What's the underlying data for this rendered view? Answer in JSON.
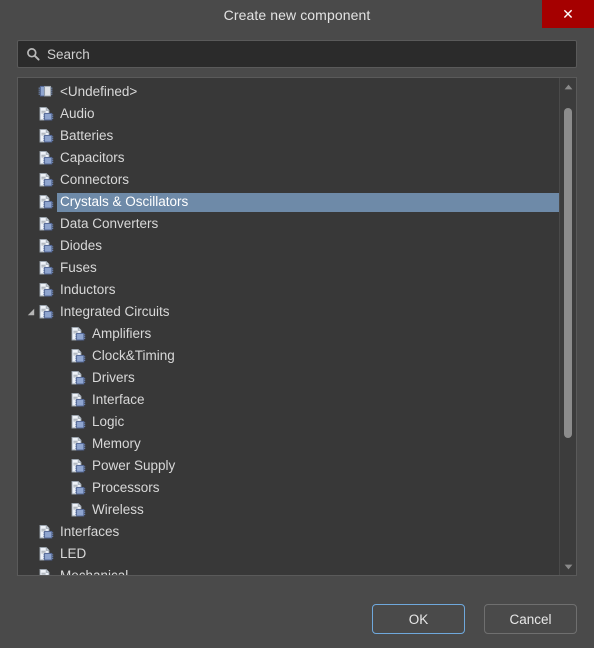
{
  "window": {
    "title": "Create new component",
    "close_icon": "close-x-icon",
    "close_color": "#a50000"
  },
  "search": {
    "icon": "search-icon",
    "placeholder": "Search",
    "value": ""
  },
  "tree": {
    "selected_label": "Crystals & Oscillators",
    "selection_color": "#6e8aa8",
    "items": [
      {
        "label": "<Undefined>",
        "level": 0,
        "icon": "chip-icon",
        "selected": false,
        "twisty": "none"
      },
      {
        "label": "Audio",
        "level": 0,
        "icon": "component-page-icon",
        "selected": false,
        "twisty": "none"
      },
      {
        "label": "Batteries",
        "level": 0,
        "icon": "component-page-icon",
        "selected": false,
        "twisty": "none"
      },
      {
        "label": "Capacitors",
        "level": 0,
        "icon": "component-page-icon",
        "selected": false,
        "twisty": "none"
      },
      {
        "label": "Connectors",
        "level": 0,
        "icon": "component-page-icon",
        "selected": false,
        "twisty": "none"
      },
      {
        "label": "Crystals & Oscillators",
        "level": 0,
        "icon": "component-page-icon",
        "selected": true,
        "twisty": "none"
      },
      {
        "label": "Data Converters",
        "level": 0,
        "icon": "component-page-icon",
        "selected": false,
        "twisty": "none"
      },
      {
        "label": "Diodes",
        "level": 0,
        "icon": "component-page-icon",
        "selected": false,
        "twisty": "none"
      },
      {
        "label": "Fuses",
        "level": 0,
        "icon": "component-page-icon",
        "selected": false,
        "twisty": "none"
      },
      {
        "label": "Inductors",
        "level": 0,
        "icon": "component-page-icon",
        "selected": false,
        "twisty": "none"
      },
      {
        "label": "Integrated Circuits",
        "level": 0,
        "icon": "component-page-icon",
        "selected": false,
        "twisty": "expanded"
      },
      {
        "label": "Amplifiers",
        "level": 1,
        "icon": "component-page-icon",
        "selected": false,
        "twisty": "none"
      },
      {
        "label": "Clock&Timing",
        "level": 1,
        "icon": "component-page-icon",
        "selected": false,
        "twisty": "none"
      },
      {
        "label": "Drivers",
        "level": 1,
        "icon": "component-page-icon",
        "selected": false,
        "twisty": "none"
      },
      {
        "label": "Interface",
        "level": 1,
        "icon": "component-page-icon",
        "selected": false,
        "twisty": "none"
      },
      {
        "label": "Logic",
        "level": 1,
        "icon": "component-page-icon",
        "selected": false,
        "twisty": "none"
      },
      {
        "label": "Memory",
        "level": 1,
        "icon": "component-page-icon",
        "selected": false,
        "twisty": "none"
      },
      {
        "label": "Power Supply",
        "level": 1,
        "icon": "component-page-icon",
        "selected": false,
        "twisty": "none"
      },
      {
        "label": "Processors",
        "level": 1,
        "icon": "component-page-icon",
        "selected": false,
        "twisty": "none"
      },
      {
        "label": "Wireless",
        "level": 1,
        "icon": "component-page-icon",
        "selected": false,
        "twisty": "none"
      },
      {
        "label": "Interfaces",
        "level": 0,
        "icon": "component-page-icon",
        "selected": false,
        "twisty": "none"
      },
      {
        "label": "LED",
        "level": 0,
        "icon": "component-page-icon",
        "selected": false,
        "twisty": "none"
      },
      {
        "label": "Mechanical",
        "level": 0,
        "icon": "component-page-icon",
        "selected": false,
        "twisty": "none"
      }
    ]
  },
  "scrollbar": {
    "up_arrow_icon": "chevron-up-icon",
    "down_arrow_icon": "chevron-down-icon",
    "thumb_top_pct": 3,
    "thumb_height_pct": 71
  },
  "footer": {
    "ok_label": "OK",
    "cancel_label": "Cancel",
    "ok_focus_color": "#6fa8dc"
  }
}
